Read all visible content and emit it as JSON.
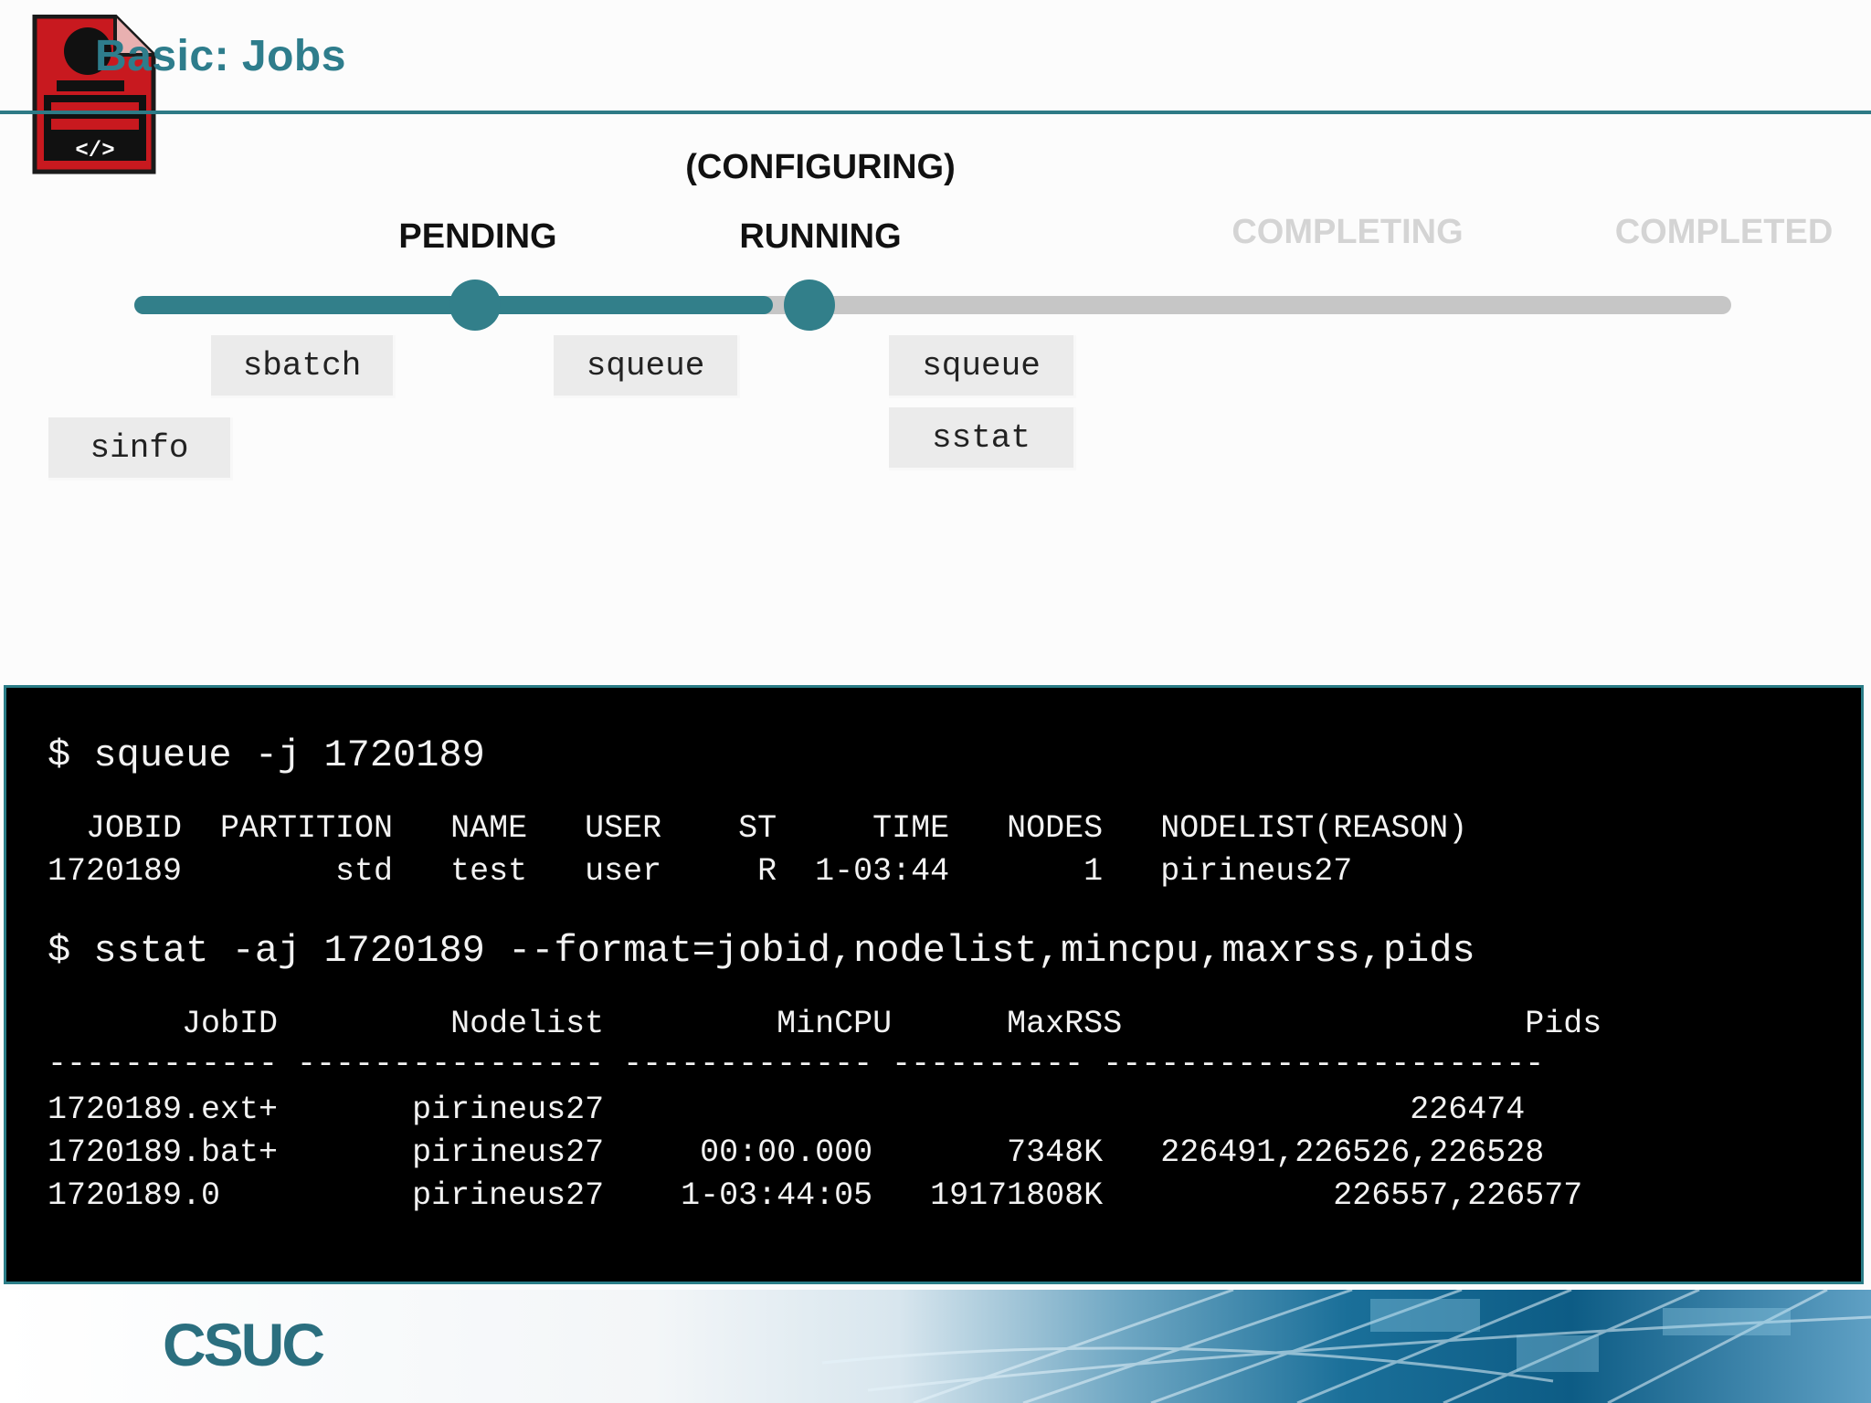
{
  "slide": {
    "title": "Basic: Jobs"
  },
  "states": [
    {
      "label": "(CONFIGURING)",
      "active": true
    },
    {
      "label": "PENDING",
      "active": true
    },
    {
      "label": "RUNNING",
      "active": true
    },
    {
      "label": "COMPLETING",
      "active": false
    },
    {
      "label": "COMPLETED",
      "active": false
    }
  ],
  "timeline_progress": 0.4,
  "commands": [
    "sbatch",
    "squeue",
    "squeue",
    "sstat",
    "sinfo"
  ],
  "terminal": {
    "lines": [
      "$ squeue -j 1720189",
      "  JOBID  PARTITION   NAME   USER    ST     TIME   NODES   NODELIST(REASON)",
      "1720189        std   test   user     R  1-03:44       1   pirineus27",
      "$ sstat -aj 1720189 --format=jobid,nodelist,mincpu,maxrss,pids",
      "       JobID         Nodelist         MinCPU      MaxRSS                     Pids",
      "------------ ---------------- ------------- ---------- -----------------------",
      "1720189.ext+       pirineus27                                          226474",
      "1720189.bat+       pirineus27     00:00.000       7348K   226491,226526,226528",
      "1720189.0          pirineus27    1-03:44:05   19171808K            226557,226577"
    ]
  },
  "footer": {
    "logo_text": "CSUC"
  },
  "colors": {
    "accent": "#2e7d8c",
    "logo_red": "#c8191f",
    "inactive": "#d4d4d4"
  },
  "icons": [
    "code-document-icon"
  ]
}
